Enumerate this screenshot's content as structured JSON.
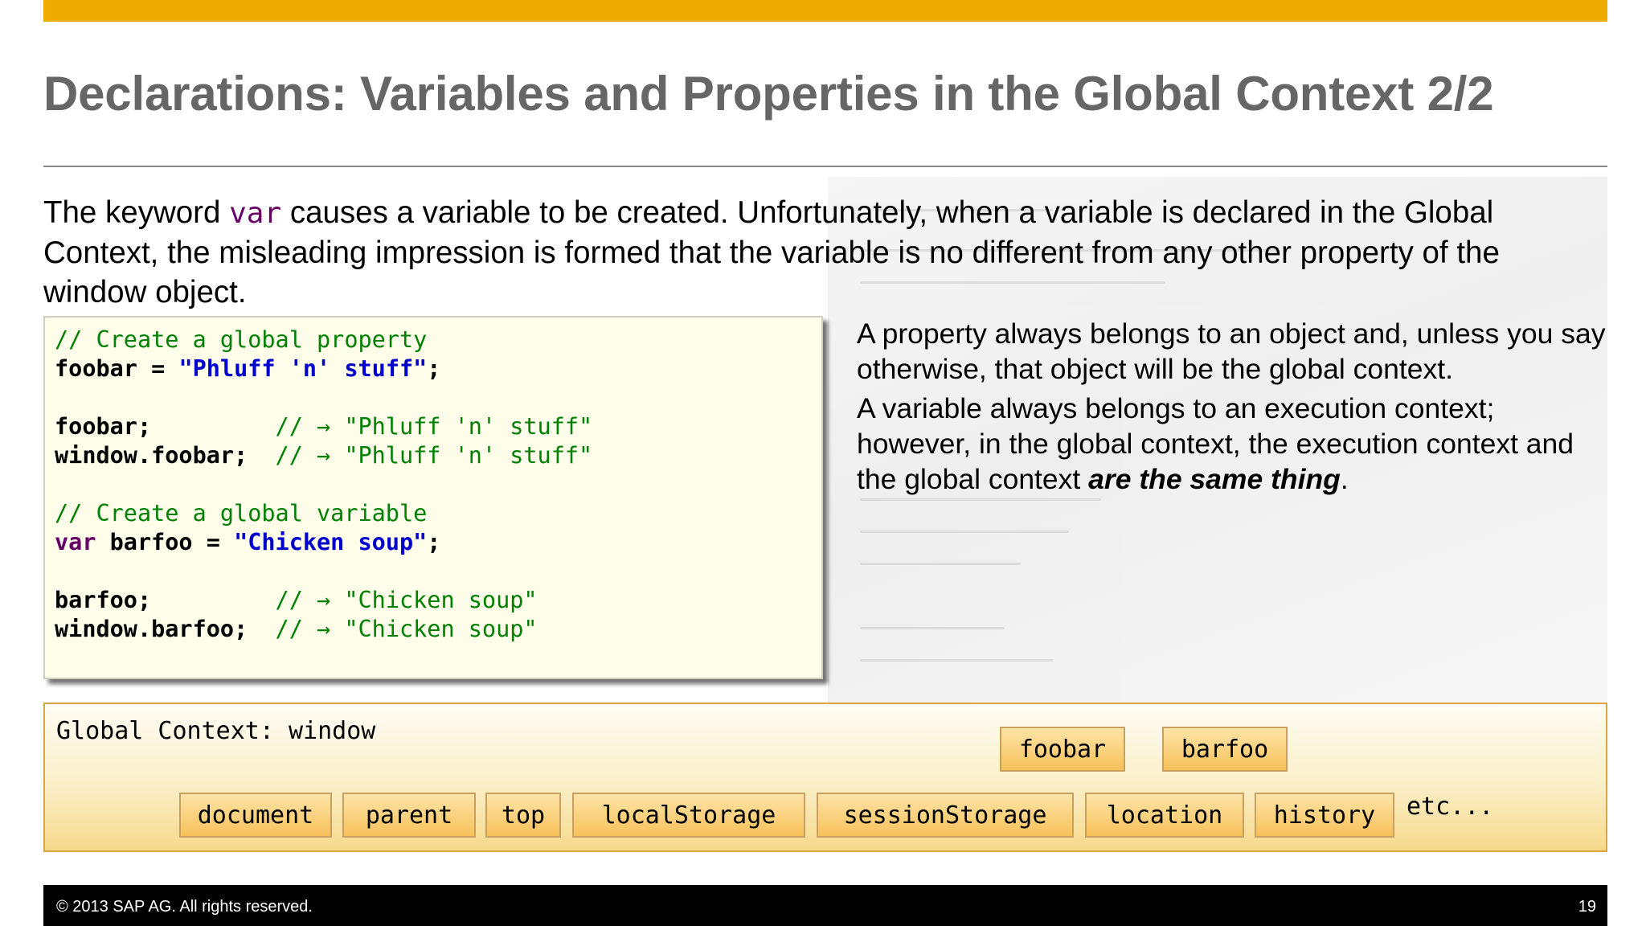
{
  "slide": {
    "title": "Declarations: Variables and Properties in the Global Context 2/2",
    "intro": {
      "before": "The keyword ",
      "keyword": "var",
      "after": " causes a variable to be created.  Unfortunately, when a variable is declared in the Global Context, the misleading impression is formed that the variable is no different from any other property of the window object."
    }
  },
  "code": {
    "line1": "// Create a global property",
    "line2_id": "foobar",
    "line2_op": " = ",
    "line2_str": "\"Phluff 'n' stuff\"",
    "line2_end": ";",
    "line4_id": "foobar;",
    "line4_pad": "         ",
    "line4_com": "// → ",
    "line4_str": "\"Phluff 'n' stuff\"",
    "line5_id": "window.foobar;",
    "line5_pad": "  ",
    "line5_com": "// → ",
    "line5_str": "\"Phluff 'n' stuff\"",
    "line7": "// Create a global variable",
    "line8_kw": "var",
    "line8_id": " barfoo",
    "line8_op": " = ",
    "line8_str": "\"Chicken soup\"",
    "line8_end": ";",
    "line10_id": "barfoo;",
    "line10_pad": "         ",
    "line10_com": "// → ",
    "line10_str": "\"Chicken soup\"",
    "line11_id": "window.barfoo;",
    "line11_pad": "  ",
    "line11_com": "// → ",
    "line11_str": "\"Chicken soup\""
  },
  "side_text": {
    "para1": "A property always belongs to an object and, unless you say otherwise, that object will be the global context.",
    "para2_before": "A variable always belongs to an execution context; however, in the global context, the execution context and the global context ",
    "para2_emph": "are the same thing",
    "para2_after": "."
  },
  "global_context": {
    "label": "Global Context: window",
    "user_properties": [
      "foobar",
      "barfoo"
    ],
    "builtin_properties": [
      "document",
      "parent",
      "top",
      "localStorage",
      "sessionStorage",
      "location",
      "history"
    ],
    "etc": "etc..."
  },
  "footer": {
    "copyright": "©  2013 SAP AG. All rights reserved.",
    "page_number": "19"
  },
  "colors": {
    "accent": "#f0ab00",
    "title": "#666666",
    "code_comment": "#008000",
    "code_string": "#0000cc",
    "code_keyword": "#660066"
  }
}
